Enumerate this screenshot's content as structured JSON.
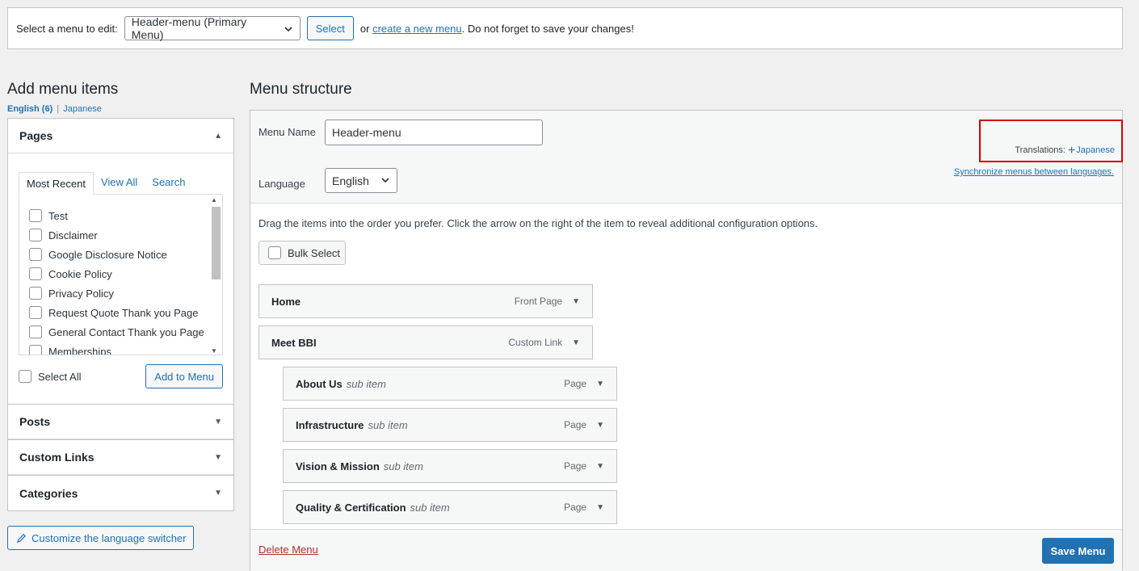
{
  "top_bar": {
    "label": "Select a menu to edit:",
    "menu_select_value": "Header-menu (Primary Menu)",
    "select_button": "Select",
    "or_text": "or",
    "create_link": "create a new menu",
    "reminder": ". Do not forget to save your changes!"
  },
  "left": {
    "title": "Add menu items",
    "lang_current": "English (6)",
    "lang_sep": "|",
    "lang_other": "Japanese",
    "pages": {
      "title": "Pages",
      "tabs": [
        "Most Recent",
        "View All",
        "Search"
      ],
      "items": [
        "Test",
        "Disclaimer",
        "Google Disclosure Notice",
        "Cookie Policy",
        "Privacy Policy",
        "Request Quote Thank you Page",
        "General Contact Thank you Page",
        "Memberships"
      ],
      "select_all": "Select All",
      "add_button": "Add to Menu"
    },
    "sections": [
      "Posts",
      "Custom Links",
      "Categories"
    ],
    "customize_button": "Customize the language switcher"
  },
  "right": {
    "title": "Menu structure",
    "menu_name_label": "Menu Name",
    "menu_name_value": "Header-menu",
    "language_label": "Language",
    "language_value": "English",
    "translations_label": "Translations:",
    "translations_link": "Japanese",
    "sync_link": "Synchronize menus between languages.",
    "instructions": "Drag the items into the order you prefer. Click the arrow on the right of the item to reveal additional configuration options.",
    "bulk_select": "Bulk Select",
    "items": [
      {
        "title": "Home",
        "sub": "",
        "type": "Front Page"
      },
      {
        "title": "Meet BBI",
        "sub": "",
        "type": "Custom Link"
      },
      {
        "title": "About Us",
        "sub": "sub item",
        "type": "Page"
      },
      {
        "title": "Infrastructure",
        "sub": "sub item",
        "type": "Page"
      },
      {
        "title": "Vision & Mission",
        "sub": "sub item",
        "type": "Page"
      },
      {
        "title": "Quality & Certification",
        "sub": "sub item",
        "type": "Page"
      }
    ],
    "delete_link": "Delete Menu",
    "save_button": "Save Menu"
  },
  "colors": {
    "accent": "#2271b1",
    "danger": "#b32d2e",
    "highlight_box": "#d60000"
  }
}
